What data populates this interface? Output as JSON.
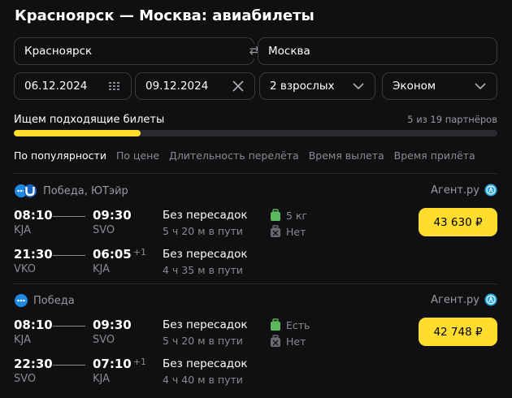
{
  "header": {
    "title": "Красноярск — Москва: авиабилеты"
  },
  "search": {
    "from": "Красноярск",
    "to": "Москва",
    "date_out": "06.12.2024",
    "date_back": "09.12.2024",
    "passengers": "2 взрослых",
    "cabin_class": "Эконом"
  },
  "progress": {
    "label": "Ищем подходящие билеты",
    "partners": "5 из 19 партнёров",
    "fraction": 0.263
  },
  "sort": {
    "options": [
      "По популярности",
      "По цене",
      "Длительность перелёта",
      "Время вылета",
      "Время прилёта"
    ],
    "active_index": 0
  },
  "colors": {
    "accent": "#ffdd2d",
    "bag_ok": "#5cb85c",
    "logo_blue": "#1e88e5"
  },
  "results": [
    {
      "airline": "Победа, ЮТэйр",
      "agent": "Агент.ру",
      "price": "43 630 ₽",
      "baggage": [
        {
          "icon": "suitcase-icon",
          "text": "5 кг"
        },
        {
          "icon": "no-baggage-icon",
          "text": "Нет"
        }
      ],
      "segments": [
        {
          "dep_time": "08:10",
          "arr_time": "09:30",
          "day_shift": "",
          "dep_airport": "KJA",
          "arr_airport": "SVO",
          "stops": "Без пересадок",
          "duration": "5 ч 20 м в пути"
        },
        {
          "dep_time": "21:30",
          "arr_time": "06:05",
          "day_shift": "+1",
          "dep_airport": "VKO",
          "arr_airport": "KJA",
          "stops": "Без пересадок",
          "duration": "4 ч 35 м в пути"
        }
      ]
    },
    {
      "airline": "Победа",
      "agent": "Агент.ру",
      "price": "42 748 ₽",
      "baggage": [
        {
          "icon": "suitcase-icon",
          "text": "Есть"
        },
        {
          "icon": "no-baggage-icon",
          "text": "Нет"
        }
      ],
      "segments": [
        {
          "dep_time": "08:10",
          "arr_time": "09:30",
          "day_shift": "",
          "dep_airport": "KJA",
          "arr_airport": "SVO",
          "stops": "Без пересадок",
          "duration": "5 ч 20 м в пути"
        },
        {
          "dep_time": "22:30",
          "arr_time": "07:10",
          "day_shift": "+1",
          "dep_airport": "SVO",
          "arr_airport": "KJA",
          "stops": "Без пересадок",
          "duration": "4 ч 40 м в пути"
        }
      ]
    }
  ]
}
